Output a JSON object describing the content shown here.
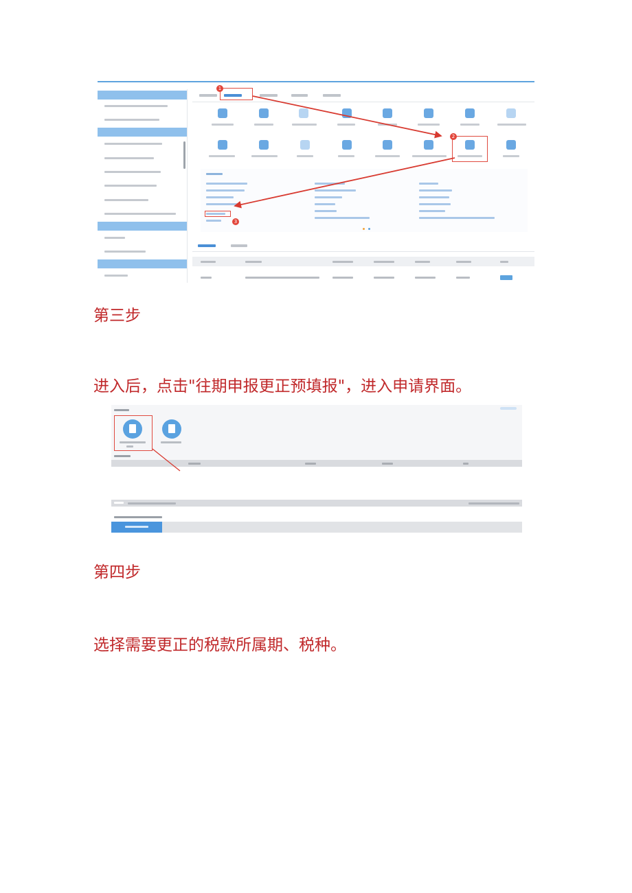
{
  "headings": {
    "step3": "第三步",
    "step3_desc": "进入后，点击\"往期申报更正预填报\"，进入申请界面。",
    "step4": "第四步",
    "step4_desc": "选择需要更正的税款所属期、税种。"
  },
  "screenshot1": {
    "badges": [
      "1",
      "2",
      "3"
    ],
    "highlight_color": "#e04a3f",
    "accent_color": "#5da3de"
  },
  "screenshot2": {
    "highlight_color": "#e04a3f",
    "accent_color": "#4a95dd"
  }
}
